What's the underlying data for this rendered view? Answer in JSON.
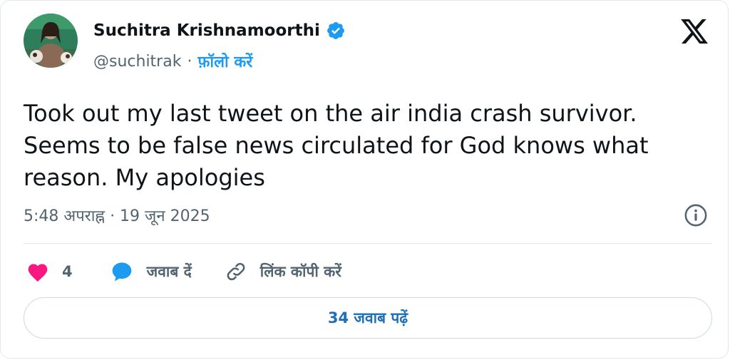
{
  "author": {
    "display_name": "Suchitra Krishnamoorthi",
    "handle": "@suchitrak",
    "separator": "·",
    "follow_label": "फ़ॉलो करें"
  },
  "tweet": {
    "text": "Took out my last tweet on the air india crash survivor. Seems to be false news circulated for God knows what reason. My apologies",
    "timestamp": "5:48 अपराह्न · 19 जून 2025"
  },
  "actions": {
    "like_count": "4",
    "reply_label": "जवाब दें",
    "copy_link_label": "लिंक कॉपी करें"
  },
  "footer": {
    "read_replies_label": "34 जवाब पढ़ें"
  },
  "icons": {
    "brand": "x-logo-icon",
    "verified": "verified-badge-icon",
    "info": "info-icon",
    "like": "heart-icon",
    "reply": "speech-bubble-icon",
    "link": "link-icon"
  },
  "colors": {
    "accent": "#1d9bf0",
    "like": "#f91880",
    "muted": "#536471",
    "text": "#0f1419",
    "border": "#e1e8ed"
  }
}
